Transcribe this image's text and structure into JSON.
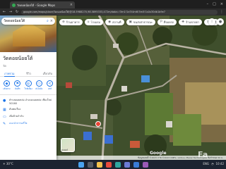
{
  "browser": {
    "tab_title": "วัดดอยน้อยใต้ - Google Maps",
    "tab_close": "×",
    "window_controls": [
      "–",
      "□",
      "×"
    ],
    "url": "google.com/maps/place/วัดดอยน้อยใต้/@18.5988270,98.5895333,472m/data=!3m1!1e3!4m6!3m5!1s0x30db1b9e7"
  },
  "panel": {
    "search_value": "วัดดอยน้อยใต้",
    "place_name": "วัดดอยน้อยใต้",
    "place_sub": "วัด",
    "tabs": [
      "ภาพรวม",
      "รีวิว",
      "เกี่ยวกับ"
    ],
    "actions": [
      {
        "icon": "◆",
        "label": "เส้นทาง"
      },
      {
        "icon": "⚑",
        "label": "บันทึก"
      },
      {
        "icon": "◎",
        "label": "ใกล้เคียง"
      },
      {
        "icon": "▭",
        "label": "ส่งไปยัง"
      },
      {
        "icon": "<",
        "label": "แชร์"
      }
    ],
    "info": [
      {
        "icon": "●",
        "text": "ตำบลดอยหล่อ อำเภอดอยหล่อ เชียงใหม่ 50160",
        "link": false
      },
      {
        "icon": "▦",
        "text": "ค้นพบเรื่อง",
        "link": false
      },
      {
        "icon": "▭",
        "text": "เพิ่มป้ายกำกับ",
        "link": false
      },
      {
        "icon": "✎",
        "text": "แนะนำการแก้ไข",
        "link": true
      }
    ]
  },
  "chips": [
    {
      "icon": "⊕",
      "label": "ร้านอาหาร"
    },
    {
      "icon": "⌂",
      "label": "โรงแรม"
    },
    {
      "icon": "◉",
      "label": "สถานที่"
    },
    {
      "icon": "▣",
      "label": "ขนส่งสาธารณะ"
    },
    {
      "icon": "P",
      "label": "ที่จอดรถ"
    },
    {
      "icon": "✚",
      "label": "ร้านขายยา"
    },
    {
      "icon": "$",
      "label": "ATM"
    }
  ],
  "map": {
    "layers_label": "เลเยอร์",
    "google_logo": "Google",
    "watermark": "Fa",
    "footer": "ข้อมูลแผนที่ ©2023  ภาพ ©2023 CNES / Airbus, Maxar Technologies  ข้อกำหนด  50 ม."
  },
  "taskbar": {
    "left": "☀ 30°C",
    "right": [
      "ENG",
      "◔",
      "10:42"
    ]
  },
  "colors": {
    "accent": "#1a73e8",
    "pin": "#ea4335",
    "chrome_dark": "#1f1f1f",
    "taskbar": "#1c2331"
  }
}
